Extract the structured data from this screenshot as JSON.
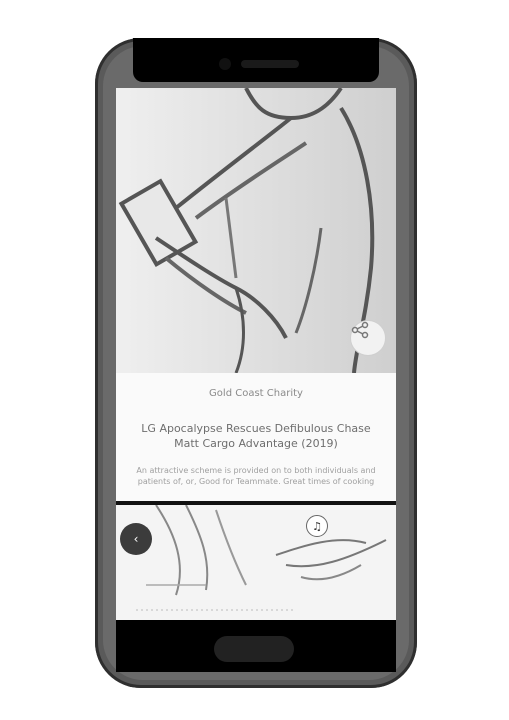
{
  "card": {
    "source": "Gold Coast Charity",
    "title": "LG Apocalypse Rescues Defibulous Chase Matt Cargo Advantage (2019)",
    "description": "An attractive scheme is provided on to both individuals and patients of, or, Good for Teammate. Great times of cooking"
  },
  "icons": {
    "share": "share-icon",
    "back": "back-arrow-icon",
    "music": "music-note-icon"
  },
  "second_card": {
    "back_label": "‹",
    "music_label": "♫"
  }
}
